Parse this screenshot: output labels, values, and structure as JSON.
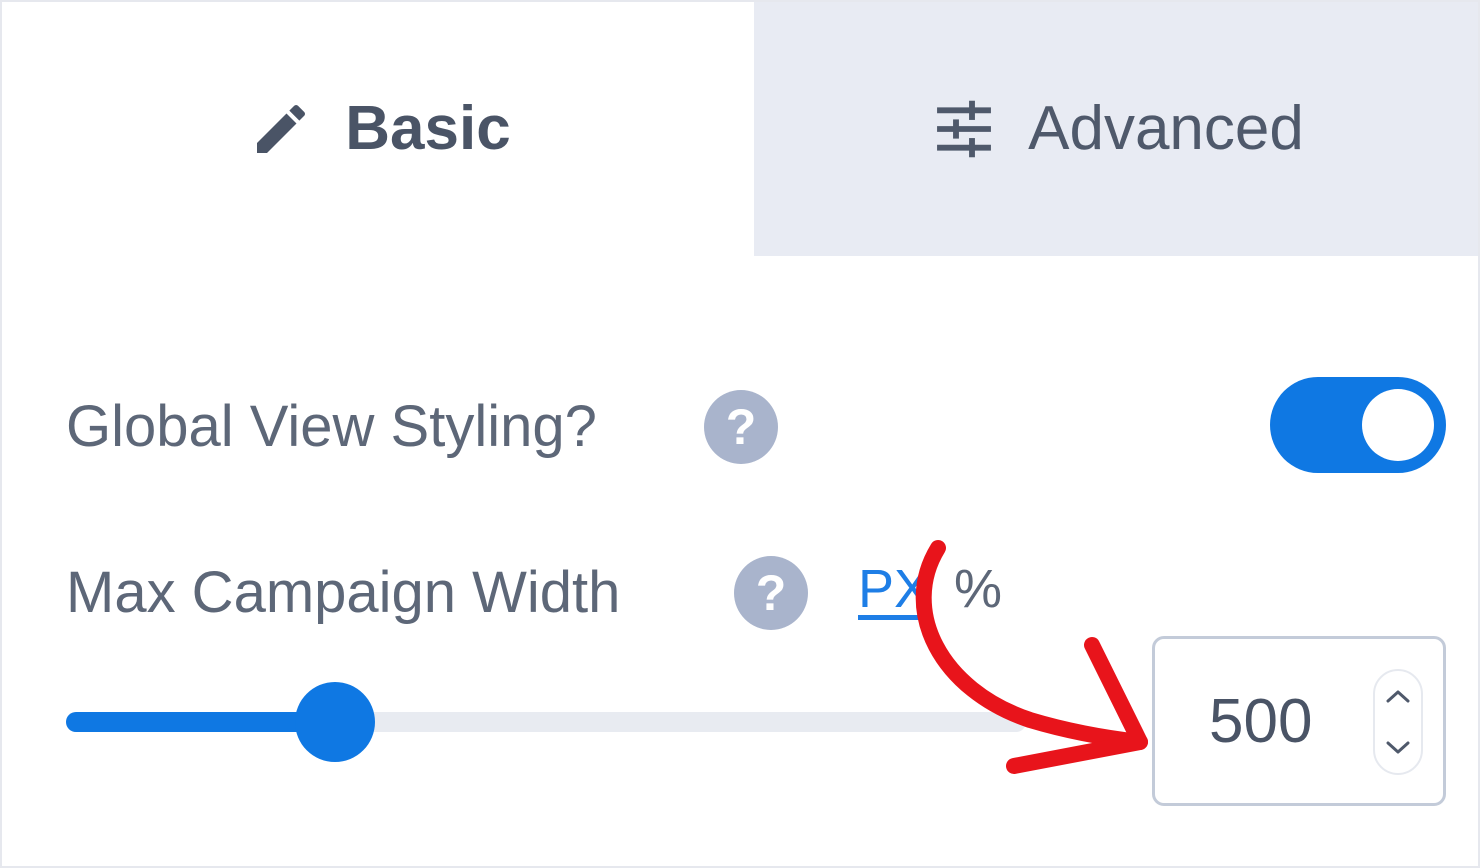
{
  "tabs": [
    {
      "label": "Basic",
      "icon": "pencil-icon",
      "active": true
    },
    {
      "label": "Advanced",
      "icon": "sliders-icon",
      "active": false
    }
  ],
  "settings": {
    "global_view_styling": {
      "label": "Global View Styling?",
      "help": "?",
      "enabled": true
    },
    "max_campaign_width": {
      "label": "Max Campaign Width",
      "help": "?",
      "units": [
        "PX",
        "%"
      ],
      "selected_unit": "PX",
      "value": "500",
      "slider_fraction": 0.28
    }
  },
  "colors": {
    "accent": "#0f78e3",
    "help_icon": "#a9b4cc",
    "inactive_tab": "#e8ebf3",
    "annotation_arrow": "#e8141b"
  }
}
